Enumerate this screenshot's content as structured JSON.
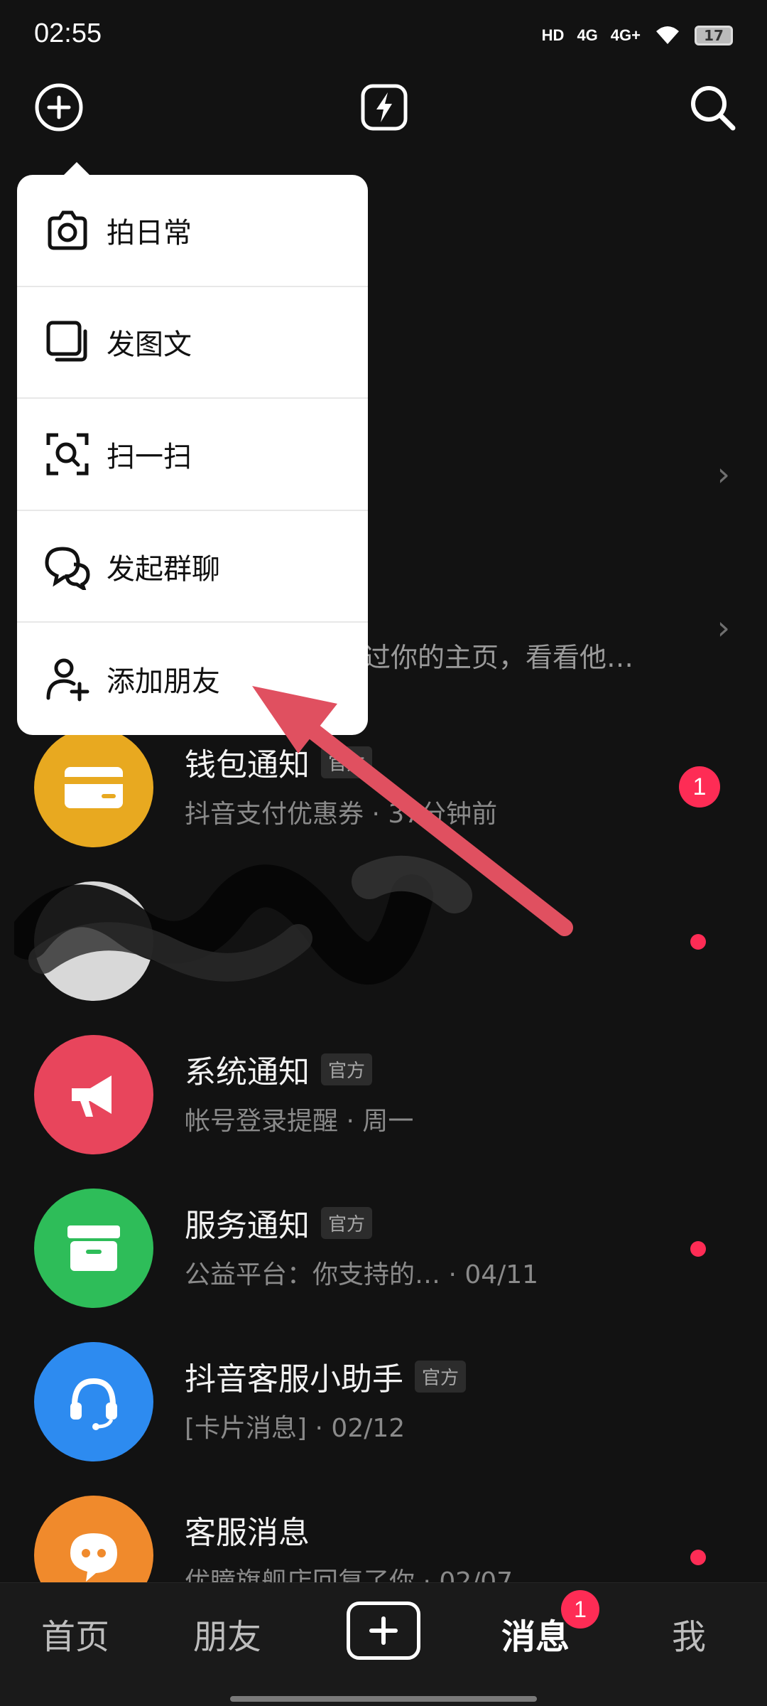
{
  "status_bar": {
    "time": "02:55",
    "hd": "HD",
    "net1": "4G",
    "net2": "4G+",
    "battery": "17"
  },
  "popup": {
    "items": [
      {
        "label": "拍日常",
        "icon": "camera-icon"
      },
      {
        "label": "发图文",
        "icon": "image-post-icon"
      },
      {
        "label": "扫一扫",
        "icon": "scan-icon"
      },
      {
        "label": "发起群聊",
        "icon": "group-chat-icon"
      },
      {
        "label": "添加朋友",
        "icon": "add-friend-icon"
      }
    ]
  },
  "peek_row": {
    "subtitle_fragment": "过你的主页，看看他…"
  },
  "chats": [
    {
      "title": "钱包通知",
      "tag": "官方",
      "subtitle": "抖音支付优惠券 ·  37分钟前",
      "badge": "1",
      "color": "#e8a920",
      "icon": "card-icon"
    },
    {
      "title": "系统通知",
      "tag": "官方",
      "subtitle": "帐号登录提醒  ·  周一",
      "color": "#e8455c",
      "icon": "megaphone-icon"
    },
    {
      "title": "服务通知",
      "tag": "官方",
      "subtitle": "公益平台：你支持的…   ·  04/11",
      "color": "#2ebd59",
      "icon": "inbox-icon"
    },
    {
      "title": "抖音客服小助手",
      "tag": "官方",
      "subtitle": "[卡片消息]  ·  02/12",
      "color": "#2d8bf0",
      "icon": "headset-icon"
    },
    {
      "title": "客服消息",
      "subtitle": "优瞳旗舰店回复了你  ·  02/07",
      "color": "#f08a2c",
      "icon": "chat-bubble-icon"
    }
  ],
  "nav": {
    "home": "首页",
    "friends": "朋友",
    "messages": "消息",
    "me": "我",
    "messages_badge": "1"
  }
}
